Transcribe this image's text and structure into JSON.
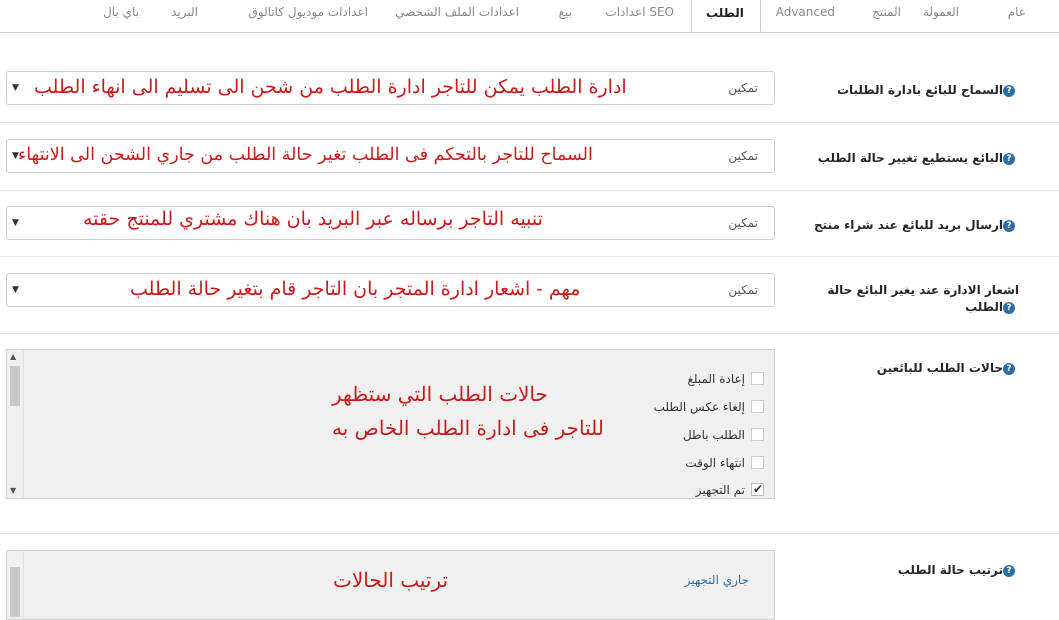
{
  "tabs": [
    {
      "label": "عام",
      "active": false
    },
    {
      "label": "العمولة",
      "active": false
    },
    {
      "label": "المنتج",
      "active": false
    },
    {
      "label": "Advanced",
      "active": false
    },
    {
      "label": "الطلب",
      "active": true
    },
    {
      "label": "اعدادات SEO",
      "active": false
    },
    {
      "label": "بيع",
      "active": false
    },
    {
      "label": "اعدادات الملف الشخصي",
      "active": false
    },
    {
      "label": "اعدادات موديول كاتالوق",
      "active": false
    },
    {
      "label": "البريد",
      "active": false
    },
    {
      "label": "باي بال",
      "active": false
    }
  ],
  "settings": [
    {
      "label": "السماح للبائع بادارة الطلبات",
      "value": "تمكين",
      "annotation": "ادارة الطلب يمكن للتاجر ادارة الطلب من شحن الى تسليم الى انهاء الطلب"
    },
    {
      "label": "البائع يستطيع تغيير حالة الطلب",
      "value": "تمكين",
      "annotation": "السماح للتاجر بالتحكم فى الطلب تغير حالة الطلب من جاري الشحن الى الانتهاء"
    },
    {
      "label": "ارسال بريد للبائع عند شراء منتج",
      "value": "تمكين",
      "annotation": "تنبيه التاجر برساله عبر البريد بان هناك مشتري للمنتج حقته"
    },
    {
      "label_line1": "اشعار الادارة عند يغير البائع حالة",
      "label_line2": "الطلب",
      "value": "تمكين",
      "annotation": "مهم - اشعار ادارة المتجر بان التاجر قام بتغير حالة الطلب"
    }
  ],
  "statuses": {
    "label": "حالات الطلب للبائعين",
    "items": [
      {
        "label": "إعادة المبلغ",
        "checked": false
      },
      {
        "label": "إلغاء عكس الطلب",
        "checked": false
      },
      {
        "label": "الطلب باطل",
        "checked": false
      },
      {
        "label": "انتهاء الوقت",
        "checked": false
      },
      {
        "label": "تم التجهيز",
        "checked": true
      }
    ],
    "annotation_line1": "حالات الطلب التي ستظهر",
    "annotation_line2": "للتاجر فى ادارة الطلب الخاص به"
  },
  "sort": {
    "label": "ترتيب حالة الطلب",
    "first_item": "جاري التجهيز",
    "annotation": "ترتيب الحالات"
  },
  "help_glyph": "?",
  "icons": {
    "select_arrow": "▼",
    "scroll_up": "▲",
    "scroll_down": "▼"
  },
  "colors": {
    "annotation": "#cc1a1a",
    "help": "#2b6ea8",
    "link": "#2b6ea8"
  }
}
